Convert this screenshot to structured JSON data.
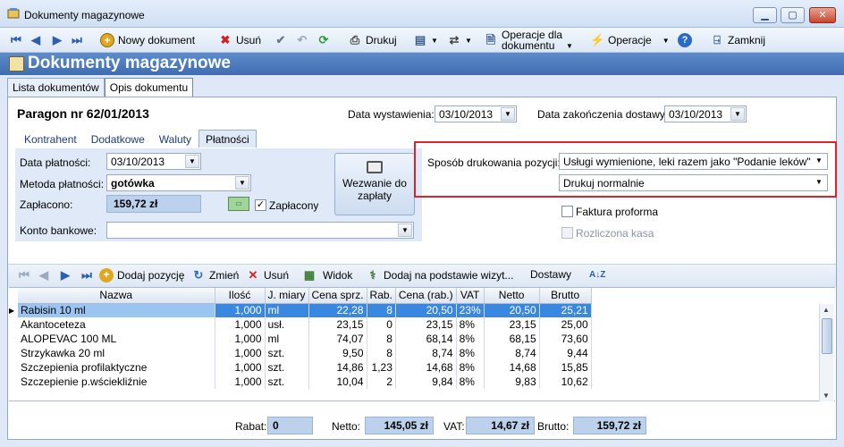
{
  "window": {
    "title": "Dokumenty magazynowe"
  },
  "toolbar": {
    "new_doc": "Nowy dokument",
    "delete": "Usuń",
    "print": "Drukuj",
    "operations_doc": [
      "Operacje dla",
      "dokumentu"
    ],
    "operations": "Operacje",
    "close": "Zamknij"
  },
  "header": {
    "title": "Dokumenty magazynowe"
  },
  "main_tabs": [
    "Lista dokumentów",
    "Opis dokumentu"
  ],
  "document": {
    "title": "Paragon nr  62/01/2013",
    "issue_date_label": "Data wystawienia:",
    "issue_date": "03/10/2013",
    "delivery_end_label": "Data zakończenia dostawy:",
    "delivery_end": "03/10/2013"
  },
  "sub_tabs": [
    "Kontrahent",
    "Dodatkowe",
    "Waluty",
    "Płatności"
  ],
  "payment": {
    "date_label": "Data płatności:",
    "date": "03/10/2013",
    "method_label": "Metoda płatności:",
    "method": "gotówka",
    "paid_label": "Zapłacono:",
    "paid": "159,72 zł",
    "paid_check_label": "Zapłacony",
    "paid_checked": "✓",
    "call_button": [
      "Wezwanie do",
      "zapłaty"
    ],
    "bank_label": "Konto bankowe:",
    "bank": ""
  },
  "print_opts": {
    "mode_label": "Sposób drukowania pozycji:",
    "mode": "Usługi wymienione, leki razem jako \"Podanie leków\"",
    "print_mode": "Drukuj normalnie",
    "proforma": "Faktura proforma",
    "settled": "Rozliczona kasa"
  },
  "grid_toolbar": {
    "add": "Dodaj pozycję",
    "change": "Zmień",
    "delete": "Usuń",
    "view": "Widok",
    "add_visit": "Dodaj na podstawie wizyt...",
    "deliveries": "Dostawy"
  },
  "grid": {
    "columns": [
      "Nazwa",
      "Ilość",
      "J. miary",
      "Cena sprz.",
      "Rab.",
      "Cena (rab.)",
      "VAT",
      "Netto",
      "Brutto"
    ],
    "rows": [
      [
        "Rabisin 10 ml",
        "1,000",
        "ml",
        "22,28",
        "8",
        "20,50",
        "23%",
        "20,50",
        "25,21"
      ],
      [
        "Akantoceteza",
        "1,000",
        "usł.",
        "23,15",
        "0",
        "23,15",
        "8%",
        "23,15",
        "25,00"
      ],
      [
        "ALOPEVAC 100 ML",
        "1,000",
        "ml",
        "74,07",
        "8",
        "68,14",
        "8%",
        "68,15",
        "73,60"
      ],
      [
        "Strzykawka 20 ml",
        "1,000",
        "szt.",
        "9,50",
        "8",
        "8,74",
        "8%",
        "8,74",
        "9,44"
      ],
      [
        "Szczepienia profilaktyczne",
        "1,000",
        "szt.",
        "14,86",
        "1,23",
        "14,68",
        "8%",
        "14,68",
        "15,85"
      ],
      [
        "Szczepienie p.wściekliźnie",
        "1,000",
        "szt.",
        "10,04",
        "2",
        "9,84",
        "8%",
        "9,83",
        "10,62"
      ]
    ]
  },
  "summary": {
    "discount_label": "Rabat:",
    "discount": "0",
    "net_label": "Netto:",
    "net": "145,05 zł",
    "vat_label": "VAT:",
    "vat": "14,67 zł",
    "gross_label": "Brutto:",
    "gross": "159,72 zł"
  }
}
